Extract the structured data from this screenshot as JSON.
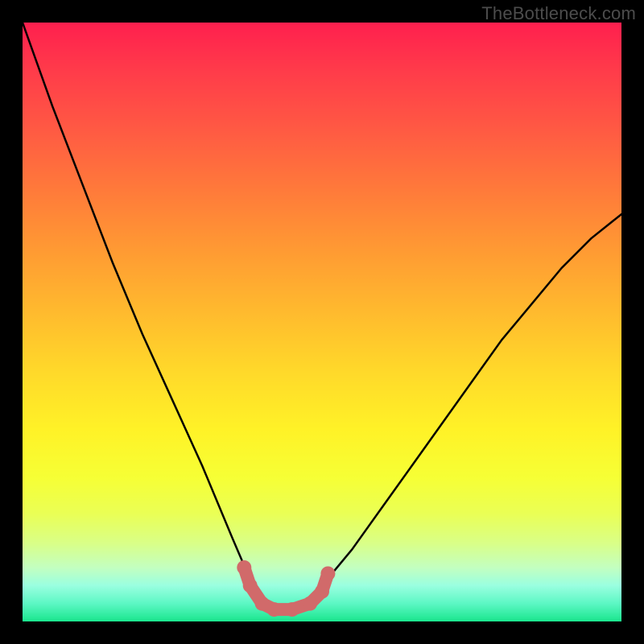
{
  "watermark": "TheBottleneck.com",
  "chart_data": {
    "type": "line",
    "title": "",
    "xlabel": "",
    "ylabel": "",
    "xlim": [
      0,
      1
    ],
    "ylim": [
      0,
      1
    ],
    "series": [
      {
        "name": "bottleneck-curve",
        "x": [
          0.0,
          0.05,
          0.1,
          0.15,
          0.2,
          0.25,
          0.3,
          0.35,
          0.38,
          0.4,
          0.42,
          0.45,
          0.48,
          0.5,
          0.55,
          0.6,
          0.65,
          0.7,
          0.75,
          0.8,
          0.85,
          0.9,
          0.95,
          1.0
        ],
        "y": [
          1.0,
          0.86,
          0.73,
          0.6,
          0.48,
          0.37,
          0.26,
          0.14,
          0.07,
          0.03,
          0.02,
          0.02,
          0.03,
          0.06,
          0.12,
          0.19,
          0.26,
          0.33,
          0.4,
          0.47,
          0.53,
          0.59,
          0.64,
          0.68
        ]
      },
      {
        "name": "valley-marker",
        "x": [
          0.37,
          0.38,
          0.4,
          0.42,
          0.45,
          0.48,
          0.5,
          0.51
        ],
        "y": [
          0.09,
          0.06,
          0.03,
          0.02,
          0.02,
          0.03,
          0.05,
          0.08
        ]
      }
    ],
    "colors": {
      "curve": "#000000",
      "marker": "#d16a6a"
    }
  }
}
